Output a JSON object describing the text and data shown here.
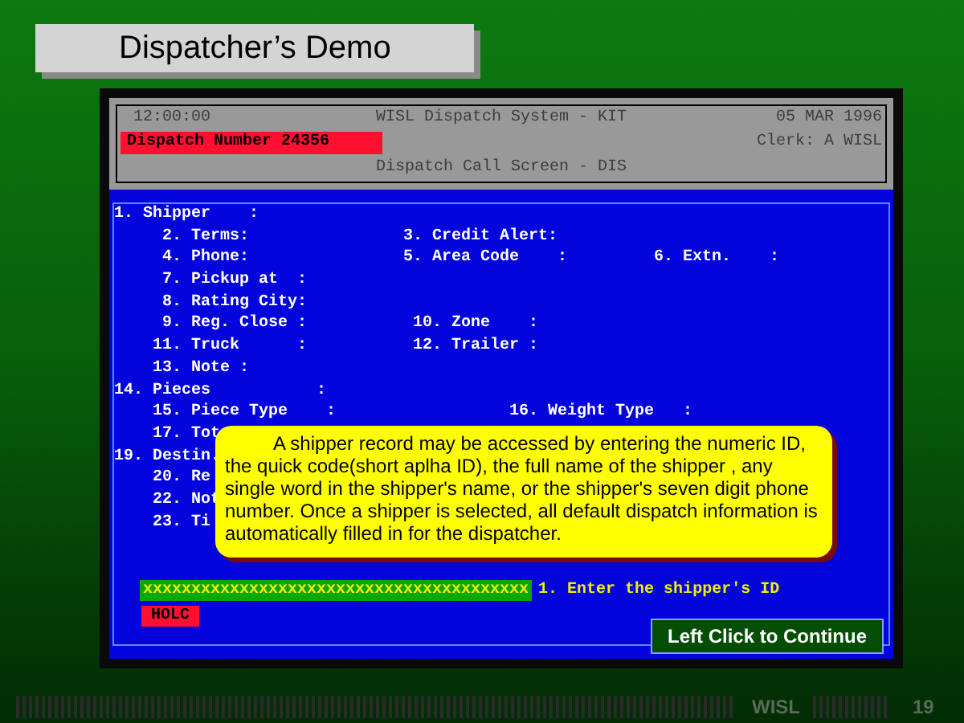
{
  "slide_title": "Dispatcher’s Demo",
  "header": {
    "time": "12:00:00",
    "system": "WISL Dispatch System - KIT",
    "date": "05 MAR 1996",
    "dispatch_number": "Dispatch Number 24356",
    "clerk": "Clerk: A WISL",
    "screen": "Dispatch Call Screen - DIS"
  },
  "field_rows": [
    [
      "1. Shipper    :"
    ],
    [
      "2. Terms:",
      "3. Credit Alert:"
    ],
    [
      "4. Phone:",
      "5. Area Code    :",
      "6. Extn.    :"
    ],
    [
      "7. Pickup at  :"
    ],
    [
      "8. Rating City:"
    ],
    [
      "9. Reg. Close :",
      "10. Zone    :"
    ],
    [
      "11. Truck      :",
      "12. Trailer :"
    ],
    [
      "13. Note :"
    ],
    [
      "14. Pieces           :"
    ],
    [
      "15. Piece Type    :",
      "16. Weight Type   :"
    ],
    [
      "17. Tot"
    ],
    [
      "19. Destin."
    ],
    [
      "20. Re"
    ],
    [
      "22. Not"
    ],
    [
      "23. Ti"
    ]
  ],
  "entry": {
    "value": "xxxxxxxxxxxxxxxxxxxxxxxxxxxxxxxxxxxxxxxx",
    "prompt": "1. Enter the shipper's ID",
    "mode": "HOLC"
  },
  "callout": "A shipper record may be accessed by  entering the numeric ID, the quick code(short aplha ID), the full name of the shipper , any single word in the shipper's name, or the shipper's seven digit phone number. Once a shipper is selected, all default dispatch information is automatically filled in for the dispatcher.",
  "continue_button": "Left Click to Continue",
  "footer": {
    "brand": "WISL",
    "page": "19"
  }
}
